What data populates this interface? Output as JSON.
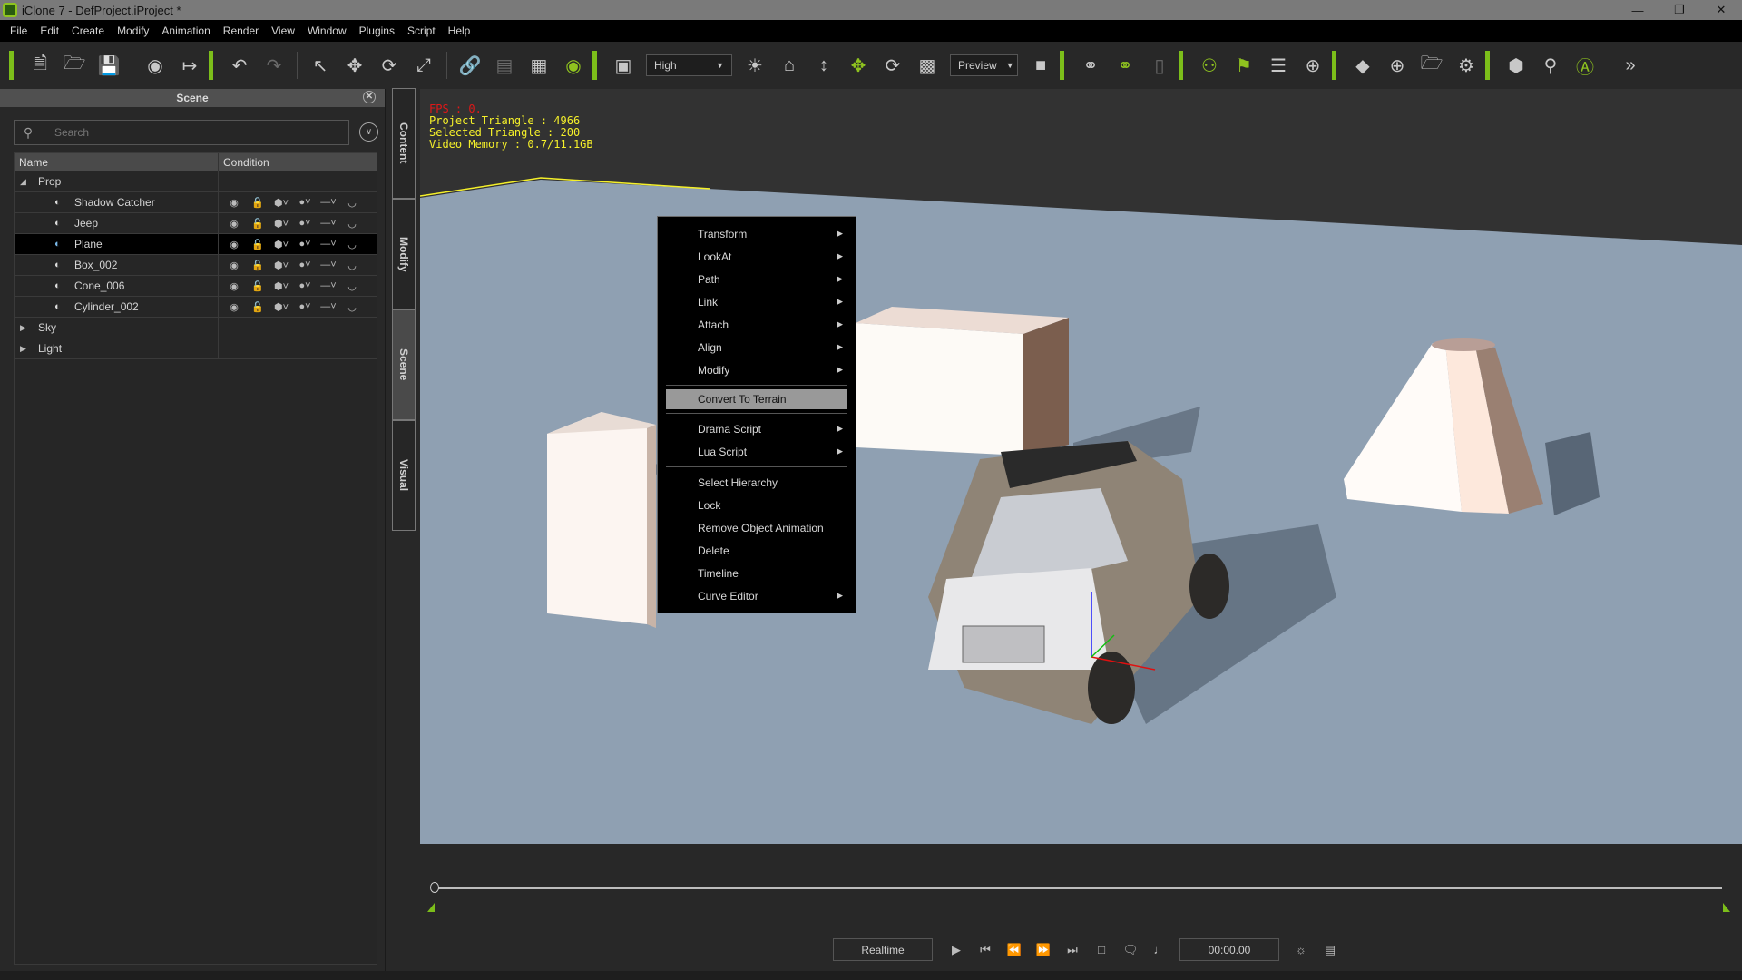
{
  "window": {
    "title": "iClone 7 - DefProject.iProject *",
    "controls": [
      "minimize",
      "restore",
      "close"
    ]
  },
  "menubar": [
    "File",
    "Edit",
    "Create",
    "Modify",
    "Animation",
    "Render",
    "View",
    "Window",
    "Plugins",
    "Script",
    "Help"
  ],
  "toolbar": {
    "quality_dropdown": "High",
    "render_dropdown": "Preview",
    "icons": [
      "new-file",
      "open-folder",
      "save",
      "preview-window",
      "export",
      "undo",
      "redo",
      "select",
      "move",
      "rotate",
      "scale",
      "link",
      "align-left",
      "align-right",
      "visibility",
      "viewport-layout",
      "light",
      "home-camera",
      "fit-vertical",
      "transform-gizmo",
      "camera-orbit",
      "frame-object",
      "video-camera",
      "motion-target",
      "motion-view",
      "modules",
      "ragdoll",
      "flag",
      "timeline-list",
      "gizmo-link",
      "key",
      "key-search",
      "key-folder",
      "key-settings",
      "headless-render",
      "animation-search",
      "auto-key",
      "more"
    ]
  },
  "scene_panel": {
    "title": "Scene",
    "search_placeholder": "Search",
    "columns": [
      "Name",
      "Condition"
    ],
    "groups": [
      {
        "label": "Prop",
        "expanded": true,
        "items": [
          {
            "label": "Shadow Catcher",
            "selected": false
          },
          {
            "label": "Jeep",
            "selected": false
          },
          {
            "label": "Plane",
            "selected": true
          },
          {
            "label": "Box_002",
            "selected": false
          },
          {
            "label": "Cone_006",
            "selected": false
          },
          {
            "label": "Cylinder_002",
            "selected": false
          }
        ]
      },
      {
        "label": "Sky",
        "expanded": false,
        "items": []
      },
      {
        "label": "Light",
        "expanded": false,
        "items": []
      }
    ]
  },
  "side_tabs": [
    {
      "label": "Content",
      "active": false
    },
    {
      "label": "Modify",
      "active": false
    },
    {
      "label": "Scene",
      "active": true
    },
    {
      "label": "Visual",
      "active": false
    }
  ],
  "viewport": {
    "stats": {
      "fps": "FPS : 0.",
      "project_triangle": "Project Triangle : 4966",
      "selected_triangle": "Selected Triangle : 200",
      "video_memory": "Video Memory : 0.7/11.1GB"
    },
    "colors": {
      "ground": "#8fa0b2",
      "background": "#323232",
      "selection_outline": "#f5f02a"
    }
  },
  "context_menu": {
    "groups": [
      [
        {
          "label": "Transform",
          "submenu": true
        },
        {
          "label": "LookAt",
          "submenu": true
        },
        {
          "label": "Path",
          "submenu": true
        },
        {
          "label": "Link",
          "submenu": true
        },
        {
          "label": "Attach",
          "submenu": true
        },
        {
          "label": "Align",
          "submenu": true
        },
        {
          "label": "Modify",
          "submenu": true
        }
      ],
      [
        {
          "label": "Convert To Terrain",
          "submenu": false,
          "highlighted": true
        }
      ],
      [
        {
          "label": "Drama Script",
          "submenu": true
        },
        {
          "label": "Lua Script",
          "submenu": true
        }
      ],
      [
        {
          "label": "Select Hierarchy",
          "submenu": false
        },
        {
          "label": "Lock",
          "submenu": false
        },
        {
          "label": "Remove Object Animation",
          "submenu": false
        },
        {
          "label": "Delete",
          "submenu": false
        },
        {
          "label": "Timeline",
          "submenu": false
        },
        {
          "label": "Curve Editor",
          "submenu": true
        }
      ]
    ]
  },
  "timeline": {
    "playback_mode": "Realtime",
    "time": "00:00.00",
    "progress": 0
  },
  "accent_color": "#7cbe1a"
}
